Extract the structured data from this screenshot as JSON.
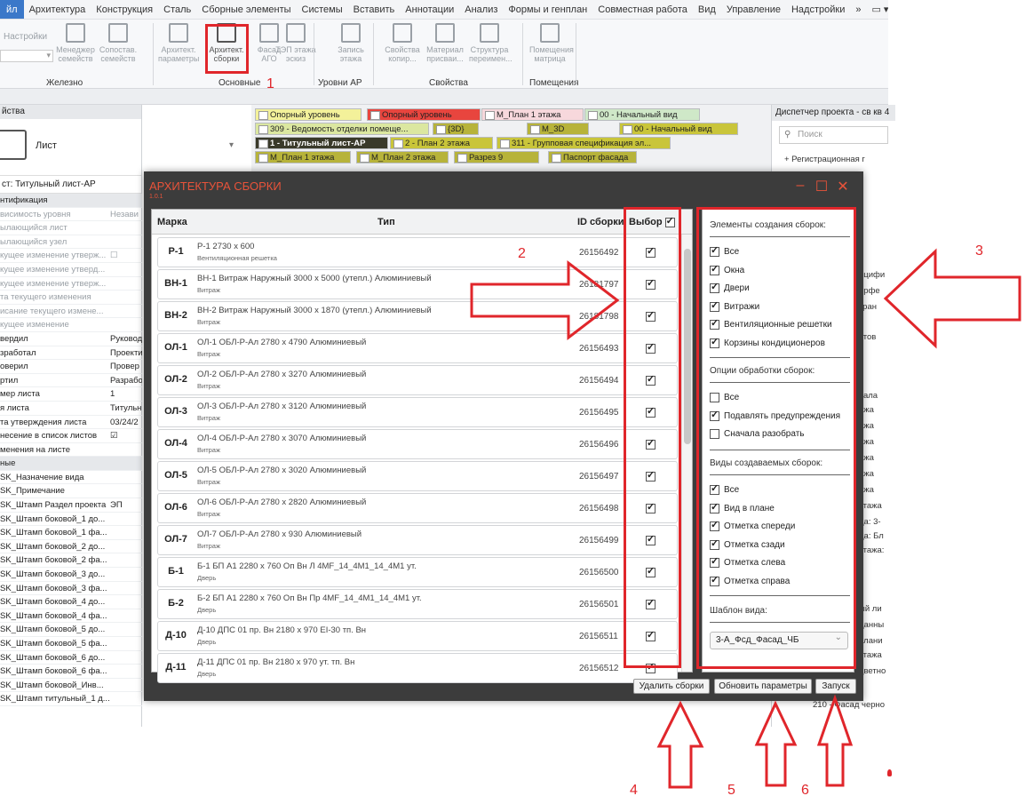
{
  "menubar": {
    "file": "йл",
    "tabs": [
      "Архитектура",
      "Конструкция",
      "Сталь",
      "Сборные элементы",
      "Системы",
      "Вставить",
      "Аннотации",
      "Анализ",
      "Формы и генплан",
      "Совместная работа",
      "Вид",
      "Управление",
      "Надстройки"
    ],
    "more": "»"
  },
  "ribbon": {
    "settings": "Настройки",
    "buttons": [
      {
        "label": "Менеджер\nсемейств"
      },
      {
        "label": "Сопостав.\nсемейств"
      },
      {
        "label": "Архитект.\nпараметры"
      },
      {
        "label": "Архитект.\nсборки"
      },
      {
        "label": "Фасад\nАГО"
      },
      {
        "label": "ТЭП этажа\nэскиз"
      },
      {
        "label": "Запись\nэтажа"
      },
      {
        "label": "Свойства\nкопир..."
      },
      {
        "label": "Материал\nприсваи..."
      },
      {
        "label": "Структура\nпереимен..."
      },
      {
        "label": "Помещения\nматрица"
      }
    ],
    "groups": [
      "Железно",
      "Основные",
      "Уровни АР",
      "Свойства",
      "Помещения"
    ]
  },
  "props": {
    "header": "йства",
    "type_name": "Лист",
    "selector": "ст: Титульный лист-АР",
    "rows": [
      {
        "k": "нтификация",
        "v": "",
        "cls": "section"
      },
      {
        "k": "висимость уровня",
        "v": "Незави",
        "cls": "grey"
      },
      {
        "k": "ылающийся лист",
        "v": "",
        "cls": "grey"
      },
      {
        "k": "ылающийся узел",
        "v": "",
        "cls": "grey"
      },
      {
        "k": "кущее изменение утверж...",
        "v": "☐",
        "cls": "grey"
      },
      {
        "k": "кущее изменение утверд...",
        "v": "",
        "cls": "grey"
      },
      {
        "k": "кущее изменение утверж...",
        "v": "",
        "cls": "grey"
      },
      {
        "k": "та текущего изменения",
        "v": "",
        "cls": "grey"
      },
      {
        "k": "исание текущего измене...",
        "v": "",
        "cls": "grey"
      },
      {
        "k": "кущее изменение",
        "v": "",
        "cls": "grey"
      },
      {
        "k": "вердил",
        "v": "Руковод",
        "cls": ""
      },
      {
        "k": "зработал",
        "v": "Проекти",
        "cls": ""
      },
      {
        "k": "оверил",
        "v": "Провер",
        "cls": ""
      },
      {
        "k": "ртил",
        "v": "Разрабо",
        "cls": ""
      },
      {
        "k": "мер листа",
        "v": "1",
        "cls": ""
      },
      {
        "k": "я листа",
        "v": "Титульн",
        "cls": ""
      },
      {
        "k": "та утверждения листа",
        "v": "03/24/2",
        "cls": ""
      },
      {
        "k": "несение в список листов",
        "v": "☑",
        "cls": ""
      },
      {
        "k": "менения на листе",
        "v": "",
        "cls": ""
      },
      {
        "k": "ные",
        "v": "",
        "cls": "section"
      },
      {
        "k": "SK_Назначение вида",
        "v": "",
        "cls": ""
      },
      {
        "k": "SK_Примечание",
        "v": "",
        "cls": ""
      },
      {
        "k": "SK_Штамп Раздел проекта",
        "v": "ЭП",
        "cls": ""
      },
      {
        "k": "SK_Штамп боковой_1 до...",
        "v": "",
        "cls": ""
      },
      {
        "k": "SK_Штамп боковой_1 фа...",
        "v": "",
        "cls": ""
      },
      {
        "k": "SK_Штамп боковой_2 до...",
        "v": "",
        "cls": ""
      },
      {
        "k": "SK_Штамп боковой_2 фа...",
        "v": "",
        "cls": ""
      },
      {
        "k": "SK_Штамп боковой_3 до...",
        "v": "",
        "cls": ""
      },
      {
        "k": "SK_Штамп боковой_3 фа...",
        "v": "",
        "cls": ""
      },
      {
        "k": "SK_Штамп боковой_4 до...",
        "v": "",
        "cls": ""
      },
      {
        "k": "SK_Штамп боковой_4 фа...",
        "v": "",
        "cls": ""
      },
      {
        "k": "SK_Штамп боковой_5 до...",
        "v": "",
        "cls": ""
      },
      {
        "k": "SK_Штамп боковой_5 фа...",
        "v": "",
        "cls": ""
      },
      {
        "k": "SK_Штамп боковой_6 до...",
        "v": "",
        "cls": ""
      },
      {
        "k": "SK_Штамп боковой_6 фа...",
        "v": "",
        "cls": ""
      },
      {
        "k": "SK_Штамп боковой_Инв...",
        "v": "",
        "cls": ""
      },
      {
        "k": "SK_Штамп титульный_1 д...",
        "v": "",
        "cls": ""
      }
    ]
  },
  "viewtabs": [
    {
      "label": "Опорный уровень",
      "color": "#f3f19a"
    },
    {
      "label": "Опорный уровень",
      "color": "#e8453e"
    },
    {
      "label": "М_План 1 этажа",
      "color": "#f7d8dc"
    },
    {
      "label": "00 - Начальный вид",
      "color": "#cfe8c8"
    },
    {
      "label": "309 - Ведомость отделки помеще...",
      "color": "#dbe7a0"
    },
    {
      "label": "{3D}",
      "color": "#b7b33a"
    },
    {
      "label": "М_3D",
      "color": "#b7b33a"
    },
    {
      "label": "00 - Начальный вид",
      "color": "#c9c53a"
    },
    {
      "label": "1 - Титульный лист-АР",
      "color": "#3a3a2a"
    },
    {
      "label": "2 - План 2 этажа",
      "color": "#c9c53a"
    },
    {
      "label": "311 - Групповая спецификация эл...",
      "color": "#c9c53a"
    },
    {
      "label": "М_План 1 этажа",
      "color": "#b7b33a"
    },
    {
      "label": "М_План 2 этажа",
      "color": "#b7b33a"
    },
    {
      "label": "Разрез 9",
      "color": "#b7b33a"
    },
    {
      "label": "Паспорт фасада",
      "color": "#b7b33a"
    }
  ],
  "browser": {
    "header": "Диспетчер проекта - св кв 4",
    "search": "Поиск",
    "items": [
      "+ Регистрационная г",
      "ецифи",
      "ерфе",
      "кран",
      "стов",
      "вала",
      "ажа",
      "ажа",
      "ажа",
      "ажа",
      "ажа",
      "ажа",
      "этажа",
      "да: 3-",
      "да: Бл",
      "этажа:",
      "ый ли",
      "данны",
      "плани",
      "этажа",
      "цветно",
      "210 - Фасад черно"
    ]
  },
  "dialog": {
    "title": "АРХИТЕКТУРА СБОРКИ",
    "version": "1.0.1",
    "minimize": "–",
    "maximize": "☐",
    "close": "✕",
    "columns": {
      "mark": "Марка",
      "type": "Тип",
      "id": "ID сборки",
      "select": "Выбор"
    },
    "rows": [
      {
        "mark": "Р-1",
        "type": "Р-1 2730 х 600",
        "sub": "Вентиляционная решетка",
        "id": "26156492",
        "checked": true
      },
      {
        "mark": "ВН-1",
        "type": "ВН-1 Витраж Наружный 3000 х 5000 (утепл.) Алюминиевый",
        "sub": "Витраж",
        "id": "26181797",
        "checked": true
      },
      {
        "mark": "ВН-2",
        "type": "ВН-2 Витраж Наружный 3000 х 1870 (утепл.) Алюминиевый",
        "sub": "Витраж",
        "id": "26181798",
        "checked": true
      },
      {
        "mark": "ОЛ-1",
        "type": "ОЛ-1 ОБЛ-Р-Ал 2780 х 4790 Алюминиевый",
        "sub": "Витраж",
        "id": "26156493",
        "checked": true
      },
      {
        "mark": "ОЛ-2",
        "type": "ОЛ-2 ОБЛ-Р-Ал 2780 х 3270 Алюминиевый",
        "sub": "Витраж",
        "id": "26156494",
        "checked": true
      },
      {
        "mark": "ОЛ-3",
        "type": "ОЛ-3 ОБЛ-Р-Ал 2780 х 3120 Алюминиевый",
        "sub": "Витраж",
        "id": "26156495",
        "checked": true
      },
      {
        "mark": "ОЛ-4",
        "type": "ОЛ-4 ОБЛ-Р-Ал 2780 х 3070 Алюминиевый",
        "sub": "Витраж",
        "id": "26156496",
        "checked": true
      },
      {
        "mark": "ОЛ-5",
        "type": "ОЛ-5 ОБЛ-Р-Ал 2780 х 3020 Алюминиевый",
        "sub": "Витраж",
        "id": "26156497",
        "checked": true
      },
      {
        "mark": "ОЛ-6",
        "type": "ОЛ-6 ОБЛ-Р-Ал 2780 х 2820 Алюминиевый",
        "sub": "Витраж",
        "id": "26156498",
        "checked": true
      },
      {
        "mark": "ОЛ-7",
        "type": "ОЛ-7 ОБЛ-Р-Ал 2780 х 930 Алюминиевый",
        "sub": "Витраж",
        "id": "26156499",
        "checked": true
      },
      {
        "mark": "Б-1",
        "type": "Б-1 БП А1 2280 х 760 Оп Вн Л 4MF_14_4M1_14_4M1 ут.",
        "sub": "Дверь",
        "id": "26156500",
        "checked": true
      },
      {
        "mark": "Б-2",
        "type": "Б-2 БП А1 2280 х 760 Оп Вн Пр 4MF_14_4M1_14_4M1 ут.",
        "sub": "Дверь",
        "id": "26156501",
        "checked": true
      },
      {
        "mark": "Д-10",
        "type": "Д-10 ДПС 01 пр. Вн 2180 х 970 EI-30 тп. Вн",
        "sub": "Дверь",
        "id": "26156511",
        "checked": true
      },
      {
        "mark": "Д-11",
        "type": "Д-11 ДПС 01 пр. Вн 2180 х 970 ут. тп. Вн",
        "sub": "Дверь",
        "id": "26156512",
        "checked": true
      }
    ],
    "options": {
      "create_header": "Элементы создания сборок:",
      "create_items": [
        {
          "label": "Все",
          "checked": true
        },
        {
          "label": "Окна",
          "checked": true
        },
        {
          "label": "Двери",
          "checked": true
        },
        {
          "label": "Витражи",
          "checked": true
        },
        {
          "label": "Вентиляционные решетки",
          "checked": true
        },
        {
          "label": "Корзины кондиционеров",
          "checked": true
        }
      ],
      "proc_header": "Опции обработки сборок:",
      "proc_items": [
        {
          "label": "Все",
          "checked": false
        },
        {
          "label": "Подавлять предупреждения",
          "checked": true
        },
        {
          "label": "Сначала разобрать",
          "checked": false
        }
      ],
      "views_header": "Виды создаваемых сборок:",
      "views_items": [
        {
          "label": "Все",
          "checked": true
        },
        {
          "label": "Вид в плане",
          "checked": true
        },
        {
          "label": "Отметка спереди",
          "checked": true
        },
        {
          "label": "Отметка сзади",
          "checked": true
        },
        {
          "label": "Отметка слева",
          "checked": true
        },
        {
          "label": "Отметка справа",
          "checked": true
        }
      ],
      "template_header": "Шаблон вида:",
      "template_value": "3-А_Фсд_Фасад_ЧБ"
    },
    "buttons": {
      "delete": "Удалить сборки",
      "update": "Обновить параметры",
      "run": "Запуск"
    }
  },
  "annotations": {
    "n1": "1",
    "n2": "2",
    "n3": "3",
    "n4": "4",
    "n5": "5",
    "n6": "6",
    "color": "#e0262b"
  }
}
